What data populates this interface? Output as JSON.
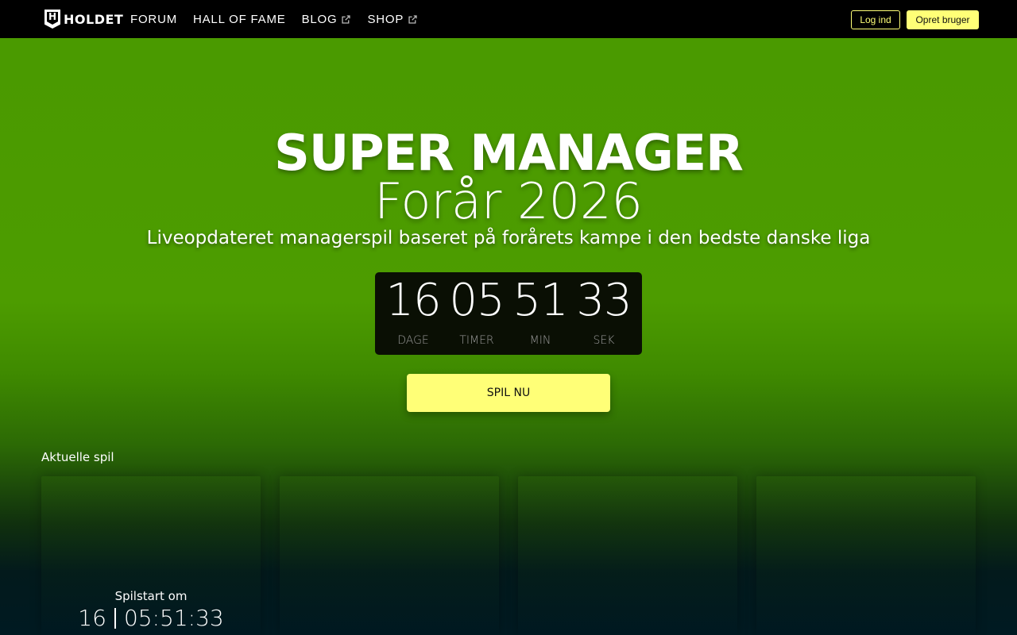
{
  "nav": {
    "logo_text": "HOLDET",
    "links": [
      {
        "label": "FORUM",
        "external": false
      },
      {
        "label": "HALL OF FAME",
        "external": false
      },
      {
        "label": "BLOG",
        "external": true
      },
      {
        "label": "SHOP",
        "external": true
      }
    ],
    "login_label": "Log ind",
    "signup_label": "Opret bruger",
    "accent_color": "#ffff77"
  },
  "hero": {
    "title": "SUPER MANAGER",
    "subtitle": "Forår 2026",
    "description": "Liveopdateret managerspil baseret på forårets kampe i den bedste danske liga",
    "countdown": [
      {
        "value": "16",
        "label": "DAGE"
      },
      {
        "value": "05",
        "label": "TIMER"
      },
      {
        "value": "51",
        "label": "MIN"
      },
      {
        "value": "33",
        "label": "SEK"
      }
    ],
    "play_label": "SPIL NU"
  },
  "current_games": {
    "title": "Aktuelle spil",
    "cards": [
      {
        "start_label": "Spilstart om",
        "days": "16",
        "time": "05:51:33"
      },
      {},
      {},
      {}
    ]
  },
  "colors": {
    "nav_bg": "#000000",
    "hero_green": "#4a9a00",
    "button_yellow": "#ffff77"
  }
}
